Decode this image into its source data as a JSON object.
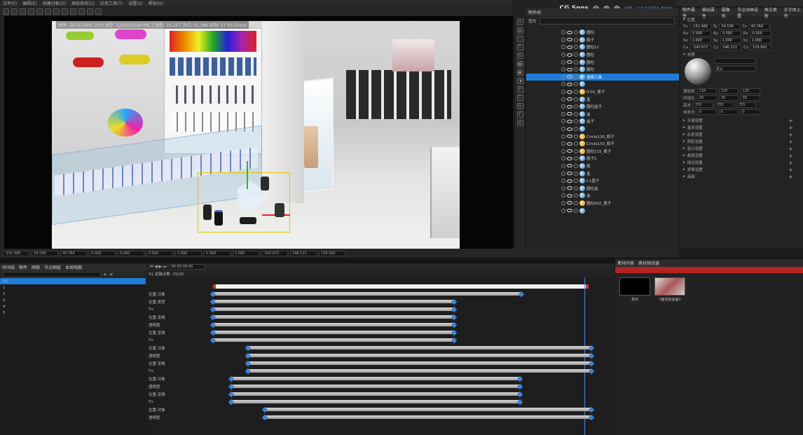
{
  "menu": {
    "items": [
      "文件(F)",
      "编辑(E)",
      "创建对象(O)",
      "高级修改(C)",
      "应用工具(T)",
      "设置(S)",
      "帮助(H)"
    ]
  },
  "brand": {
    "name": "CG Soos",
    "version": "V38 - 4.0.0.5315 Alpha"
  },
  "viewport": {
    "stats": "帧率: 50.05  GPU: 30%  显存: 2239/10240 MB  三角形: 33,257  顶点: 41,386  绘制: 57  RS  Direct"
  },
  "object_panel": {
    "title": "物件树",
    "search_label": "查找",
    "rows": [
      {
        "label": "圆柱",
        "icon": "ball"
      },
      {
        "label": "瓶子",
        "icon": "ball"
      },
      {
        "label": "圆柱11",
        "icon": "ball"
      },
      {
        "label": "圆柱",
        "icon": "ball"
      },
      {
        "label": "圆柱",
        "icon": "ball"
      },
      {
        "label": "圆柱",
        "icon": "ball"
      },
      {
        "label": "选择工具",
        "icon": "ball",
        "selected": true
      },
      {
        "label": "",
        "icon": "ball"
      },
      {
        "label": "IC02_瓶子",
        "icon": "ball2"
      },
      {
        "label": "盖",
        "icon": "ball"
      },
      {
        "label": "圆柱盒子",
        "icon": "ball"
      },
      {
        "label": "盒",
        "icon": "ball"
      },
      {
        "label": "盒子",
        "icon": "ball"
      },
      {
        "label": "",
        "icon": "ball"
      },
      {
        "label": "Circle130_瓶子",
        "icon": "ball2"
      },
      {
        "label": "Circle133_瓶子",
        "icon": "ball2"
      },
      {
        "label": "圆柱115_瓶子",
        "icon": "ball2"
      },
      {
        "label": "瓶子1",
        "icon": "ball"
      },
      {
        "label": "瓶",
        "icon": "ball"
      },
      {
        "label": "盖",
        "icon": "ball"
      },
      {
        "label": "C1盖子",
        "icon": "ball"
      },
      {
        "label": "圆柱盒",
        "icon": "ball"
      },
      {
        "label": "盒",
        "icon": "ball"
      },
      {
        "label": "圆柱002_瓶子",
        "icon": "ball2"
      },
      {
        "label": "",
        "icon": "ball"
      }
    ]
  },
  "props_panel": {
    "tabs": [
      "物件属性",
      "输出属性",
      "摄像机",
      "节点动画设置",
      "独立更新",
      "正字体上传"
    ],
    "section_position": "位置",
    "position_fields": [
      {
        "a": "Tx",
        "av": "-152.466",
        "b": "Ty",
        "bv": "34.536",
        "c": "Tz",
        "cv": "40.764"
      },
      {
        "a": "Rx",
        "av": "0.000",
        "b": "Ry",
        "bv": "0.000",
        "c": "Rz",
        "cv": "0.000"
      },
      {
        "a": "Sx",
        "av": "1.000",
        "b": "Sy",
        "bv": "1.000",
        "c": "Sz",
        "cv": "1.000"
      },
      {
        "a": "Cx",
        "av": "-242.672",
        "b": "Cy",
        "bv": "146.111",
        "c": "Cz",
        "cv": "129.992"
      }
    ],
    "section_material": "材质",
    "material_mode": "默认",
    "color_rows": [
      {
        "label": "漫反射",
        "r": "128",
        "g": "128",
        "b": "128"
      },
      {
        "label": "环境光",
        "r": "38",
        "g": "38",
        "b": "38"
      },
      {
        "label": "高光",
        "r": "255",
        "g": "255",
        "b": "255"
      },
      {
        "label": "自发光",
        "r": "0",
        "g": "0",
        "b": "0"
      }
    ],
    "collapsibles": [
      "平面设置",
      "基本设置",
      "反射设置",
      "阴影设置",
      "显示设置",
      "裁剪设置",
      "描边设置",
      "遮罩设置",
      "高级"
    ]
  },
  "transform_bar": {
    "fields": [
      "-152.466",
      "34.536",
      "40.764",
      "0.000",
      "0.000",
      "0.000",
      "1.000",
      "1.000",
      "1.000",
      "-242.672",
      "146.111",
      "129.992"
    ]
  },
  "timeline": {
    "left_tabs": [
      "时间线",
      "物件",
      "网络",
      "节点图层",
      "本地电脑"
    ],
    "tracks": [
      "S1",
      "1",
      "2",
      "3",
      "4",
      "5"
    ],
    "timecode": "00:00:00:00",
    "frame_info": "S1 关键点数: 25/25",
    "rows": [
      "位置.对象",
      "位置.类型",
      "Tx",
      "位置.变换",
      "透明度",
      "位置.变换",
      "Tx",
      "位置.对象",
      "透明度",
      "位置.变换",
      "Tx",
      "位置.对象",
      "透明度",
      "位置.变换",
      "Tx",
      "位置.对象",
      "透明度"
    ]
  },
  "materials": {
    "tabs": [
      "素材列表",
      "素材预览器"
    ],
    "items": [
      {
        "name": "素材"
      },
      {
        "name": "3面渲染画面2"
      }
    ]
  }
}
